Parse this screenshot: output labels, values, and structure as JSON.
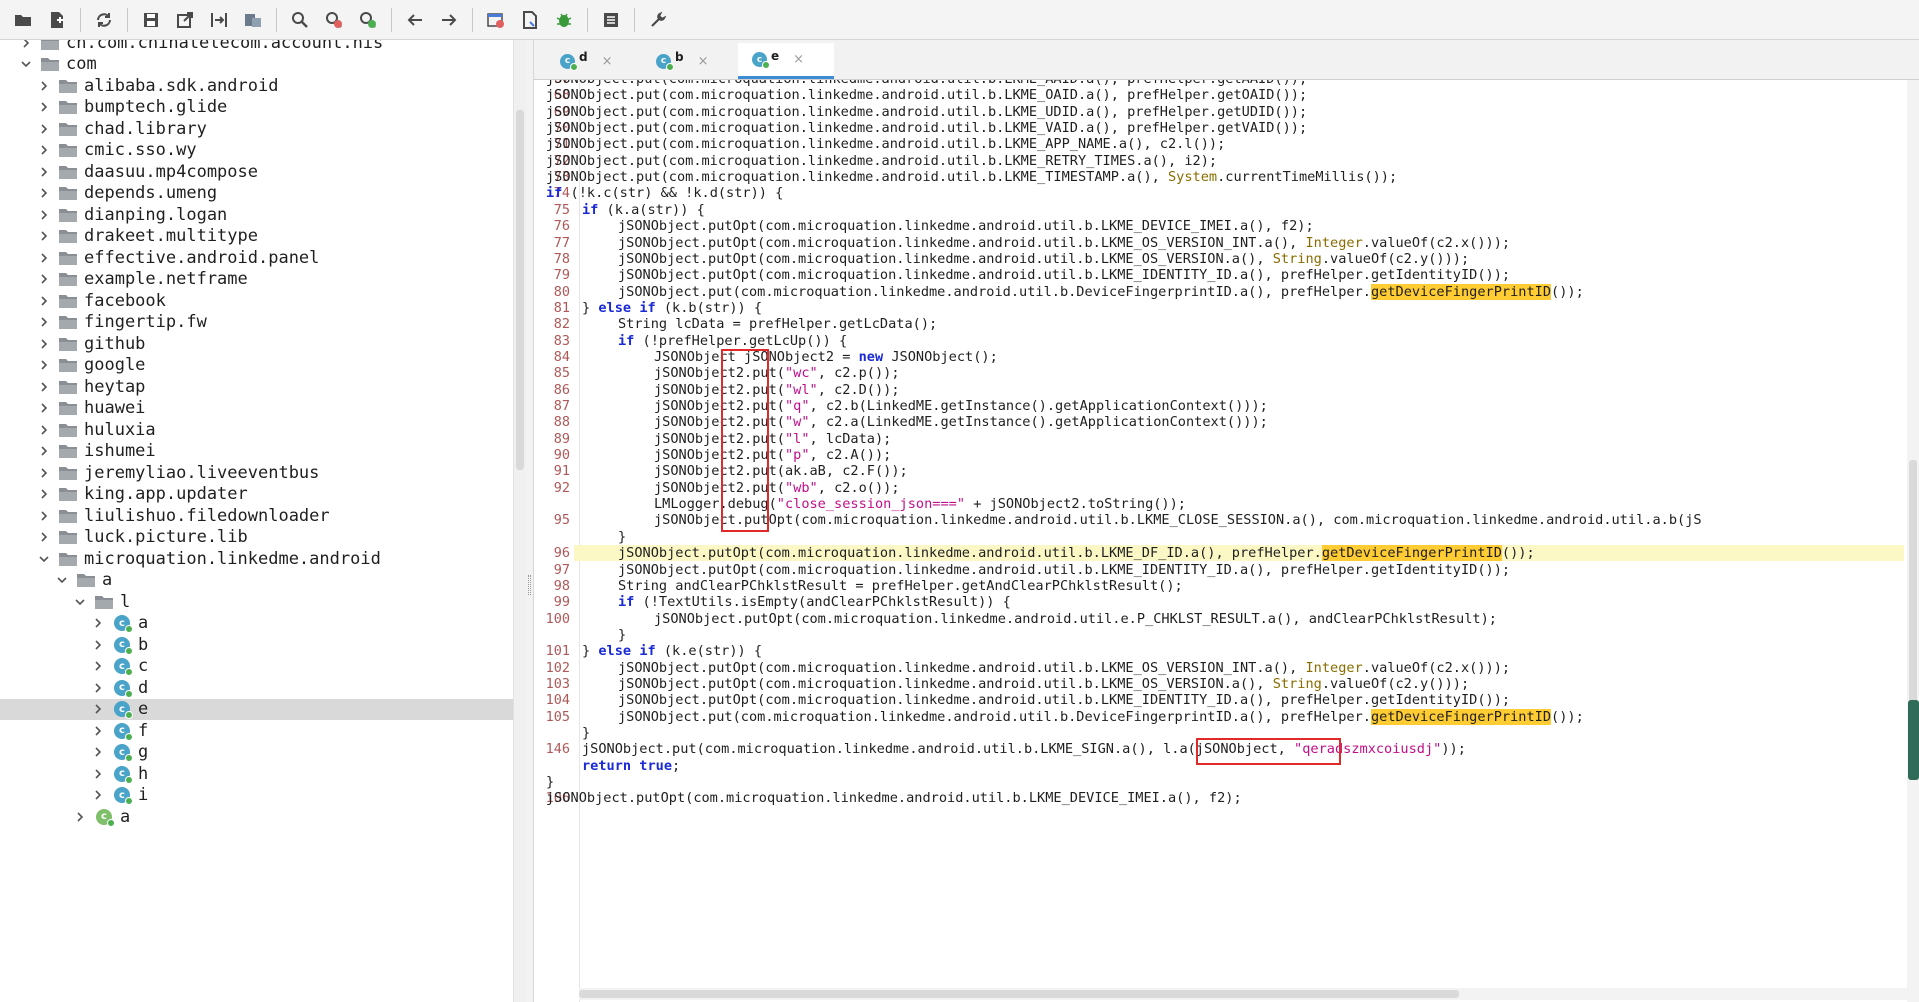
{
  "toolbar": {
    "buttons": [
      {
        "name": "open-folder-icon"
      },
      {
        "name": "add-file-icon"
      },
      {
        "name": "sync-icon"
      },
      {
        "name": "save-icon"
      },
      {
        "name": "export-icon"
      },
      {
        "name": "flatten-icon"
      },
      {
        "name": "packages-icon"
      },
      {
        "name": "search-icon"
      },
      {
        "name": "search-class-icon"
      },
      {
        "name": "search-usage-icon"
      },
      {
        "name": "back-arrow-icon"
      },
      {
        "name": "forward-arrow-icon"
      },
      {
        "name": "deobfuscate-icon"
      },
      {
        "name": "decompile-icon"
      },
      {
        "name": "debug-bug-icon"
      },
      {
        "name": "log-icon"
      },
      {
        "name": "preferences-icon"
      }
    ]
  },
  "tree": {
    "items": [
      {
        "label": "cn.com.chinatelecom.account.nis",
        "depth": 1,
        "type": "package",
        "expanded": false
      },
      {
        "label": "com",
        "depth": 1,
        "type": "package",
        "expanded": true
      },
      {
        "label": "alibaba.sdk.android",
        "depth": 2,
        "type": "package",
        "expanded": false
      },
      {
        "label": "bumptech.glide",
        "depth": 2,
        "type": "package",
        "expanded": false
      },
      {
        "label": "chad.library",
        "depth": 2,
        "type": "package",
        "expanded": false
      },
      {
        "label": "cmic.sso.wy",
        "depth": 2,
        "type": "package",
        "expanded": false
      },
      {
        "label": "daasuu.mp4compose",
        "depth": 2,
        "type": "package",
        "expanded": false
      },
      {
        "label": "depends.umeng",
        "depth": 2,
        "type": "package",
        "expanded": false
      },
      {
        "label": "dianping.logan",
        "depth": 2,
        "type": "package",
        "expanded": false
      },
      {
        "label": "drakeet.multitype",
        "depth": 2,
        "type": "package",
        "expanded": false
      },
      {
        "label": "effective.android.panel",
        "depth": 2,
        "type": "package",
        "expanded": false
      },
      {
        "label": "example.netframe",
        "depth": 2,
        "type": "package",
        "expanded": false
      },
      {
        "label": "facebook",
        "depth": 2,
        "type": "package",
        "expanded": false
      },
      {
        "label": "fingertip.fw",
        "depth": 2,
        "type": "package",
        "expanded": false
      },
      {
        "label": "github",
        "depth": 2,
        "type": "package",
        "expanded": false
      },
      {
        "label": "google",
        "depth": 2,
        "type": "package",
        "expanded": false
      },
      {
        "label": "heytap",
        "depth": 2,
        "type": "package",
        "expanded": false
      },
      {
        "label": "huawei",
        "depth": 2,
        "type": "package",
        "expanded": false
      },
      {
        "label": "huluxia",
        "depth": 2,
        "type": "package",
        "expanded": false
      },
      {
        "label": "ishumei",
        "depth": 2,
        "type": "package",
        "expanded": false
      },
      {
        "label": "jeremyliao.liveeventbus",
        "depth": 2,
        "type": "package",
        "expanded": false
      },
      {
        "label": "king.app.updater",
        "depth": 2,
        "type": "package",
        "expanded": false
      },
      {
        "label": "liulishuo.filedownloader",
        "depth": 2,
        "type": "package",
        "expanded": false
      },
      {
        "label": "luck.picture.lib",
        "depth": 2,
        "type": "package",
        "expanded": false
      },
      {
        "label": "microquation.linkedme.android",
        "depth": 2,
        "type": "package",
        "expanded": true
      },
      {
        "label": "a",
        "depth": 3,
        "type": "package",
        "expanded": true
      },
      {
        "label": "l",
        "depth": 4,
        "type": "package",
        "expanded": true
      },
      {
        "label": "a",
        "depth": 5,
        "type": "class",
        "expanded": false
      },
      {
        "label": "b",
        "depth": 5,
        "type": "class",
        "expanded": false
      },
      {
        "label": "c",
        "depth": 5,
        "type": "class",
        "expanded": false
      },
      {
        "label": "d",
        "depth": 5,
        "type": "class",
        "expanded": false
      },
      {
        "label": "e",
        "depth": 5,
        "type": "class",
        "expanded": false,
        "selected": true
      },
      {
        "label": "f",
        "depth": 5,
        "type": "class",
        "expanded": false
      },
      {
        "label": "g",
        "depth": 5,
        "type": "class",
        "expanded": false
      },
      {
        "label": "h",
        "depth": 5,
        "type": "class",
        "expanded": false
      },
      {
        "label": "i",
        "depth": 5,
        "type": "class",
        "expanded": false
      },
      {
        "label": "a",
        "depth": 4,
        "type": "class-partial",
        "expanded": false
      }
    ]
  },
  "tabs": [
    {
      "label": "d",
      "icon": "class-icon",
      "close": "×",
      "active": false
    },
    {
      "label": "b",
      "icon": "class-icon",
      "close": "×",
      "active": false
    },
    {
      "label": "e",
      "icon": "class-icon",
      "close": "×",
      "active": true
    }
  ],
  "code": {
    "lines": [
      {
        "num": "67",
        "indent": 2,
        "text": "jSONObject.put(com.microquation.linkedme.android.util.b.LKME_AAID.a(), prefHelper.getAAID());"
      },
      {
        "num": "68",
        "indent": 2,
        "text": "jSONObject.put(com.microquation.linkedme.android.util.b.LKME_OAID.a(), prefHelper.getOAID());"
      },
      {
        "num": "69",
        "indent": 2,
        "text": "jSONObject.put(com.microquation.linkedme.android.util.b.LKME_UDID.a(), prefHelper.getUDID());"
      },
      {
        "num": "70",
        "indent": 2,
        "text": "jSONObject.put(com.microquation.linkedme.android.util.b.LKME_VAID.a(), prefHelper.getVAID());"
      },
      {
        "num": "71",
        "indent": 2,
        "text": "jSONObject.put(com.microquation.linkedme.android.util.b.LKME_APP_NAME.a(), c2.l());"
      },
      {
        "num": "72",
        "indent": 2,
        "text": "jSONObject.put(com.microquation.linkedme.android.util.b.LKME_RETRY_TIMES.a(), i2);"
      },
      {
        "num": "73",
        "indent": 2,
        "text": "jSONObject.put(com.microquation.linkedme.android.util.b.LKME_TIMESTAMP.a(), System.currentTimeMillis());"
      },
      {
        "num": "74",
        "indent": 2,
        "text": "if (!k.c(str) && !k.d(str)) {"
      },
      {
        "num": "75",
        "indent": 3,
        "text": "if (k.a(str)) {"
      },
      {
        "num": "76",
        "indent": 4,
        "text": "jSONObject.putOpt(com.microquation.linkedme.android.util.b.LKME_DEVICE_IMEI.a(), f2);"
      },
      {
        "num": "77",
        "indent": 4,
        "text": "jSONObject.putOpt(com.microquation.linkedme.android.util.b.LKME_OS_VERSION_INT.a(), Integer.valueOf(c2.x()));"
      },
      {
        "num": "78",
        "indent": 4,
        "text": "jSONObject.putOpt(com.microquation.linkedme.android.util.b.LKME_OS_VERSION.a(), String.valueOf(c2.y()));"
      },
      {
        "num": "79",
        "indent": 4,
        "text": "jSONObject.putOpt(com.microquation.linkedme.android.util.b.LKME_IDENTITY_ID.a(), prefHelper.getIdentityID());"
      },
      {
        "num": "80",
        "indent": 4,
        "text": "jSONObject.put(com.microquation.linkedme.android.util.b.DeviceFingerprintID.a(), prefHelper.getDeviceFingerPrintID());"
      },
      {
        "num": "81",
        "indent": 3,
        "text": "} else if (k.b(str)) {"
      },
      {
        "num": "82",
        "indent": 4,
        "text": "String lcData = prefHelper.getLcData();"
      },
      {
        "num": "83",
        "indent": 4,
        "text": "if (!prefHelper.getLcUp()) {"
      },
      {
        "num": "84",
        "indent": 5,
        "text": "JSONObject jSONObject2 = new JSONObject();"
      },
      {
        "num": "85",
        "indent": 5,
        "text": "jSONObject2.put(\"wc\", c2.p());"
      },
      {
        "num": "86",
        "indent": 5,
        "text": "jSONObject2.put(\"wl\", c2.D());"
      },
      {
        "num": "87",
        "indent": 5,
        "text": "jSONObject2.put(\"q\", c2.b(LinkedME.getInstance().getApplicationContext()));"
      },
      {
        "num": "88",
        "indent": 5,
        "text": "jSONObject2.put(\"w\", c2.a(LinkedME.getInstance().getApplicationContext()));"
      },
      {
        "num": "89",
        "indent": 5,
        "text": "jSONObject2.put(\"l\", lcData);"
      },
      {
        "num": "90",
        "indent": 5,
        "text": "jSONObject2.put(\"p\", c2.A());"
      },
      {
        "num": "91",
        "indent": 5,
        "text": "jSONObject2.put(ak.aB, c2.F());"
      },
      {
        "num": "92",
        "indent": 5,
        "text": "jSONObject2.put(\"wb\", c2.o());"
      },
      {
        "num": "",
        "indent": 5,
        "text": "LMLogger.debug(\"close_session_json===\" + jSONObject2.toString());"
      },
      {
        "num": "95",
        "indent": 5,
        "text": "jSONObject.putOpt(com.microquation.linkedme.android.util.b.LKME_CLOSE_SESSION.a(), com.microquation.linkedme.android.util.a.b(jS"
      },
      {
        "num": "",
        "indent": 4,
        "text": "}"
      },
      {
        "num": "96",
        "indent": 4,
        "text": "jSONObject.putOpt(com.microquation.linkedme.android.util.b.LKME_DF_ID.a(), prefHelper.getDeviceFingerPrintID());"
      },
      {
        "num": "97",
        "indent": 4,
        "text": "jSONObject.putOpt(com.microquation.linkedme.android.util.b.LKME_IDENTITY_ID.a(), prefHelper.getIdentityID());"
      },
      {
        "num": "98",
        "indent": 4,
        "text": "String andClearPChklstResult = prefHelper.getAndClearPChklstResult();"
      },
      {
        "num": "99",
        "indent": 4,
        "text": "if (!TextUtils.isEmpty(andClearPChklstResult)) {"
      },
      {
        "num": "100",
        "indent": 5,
        "text": "jSONObject.putOpt(com.microquation.linkedme.android.util.e.P_CHKLST_RESULT.a(), andClearPChklstResult);"
      },
      {
        "num": "",
        "indent": 4,
        "text": "}"
      },
      {
        "num": "101",
        "indent": 3,
        "text": "} else if (k.e(str)) {"
      },
      {
        "num": "102",
        "indent": 4,
        "text": "jSONObject.putOpt(com.microquation.linkedme.android.util.b.LKME_OS_VERSION_INT.a(), Integer.valueOf(c2.x()));"
      },
      {
        "num": "103",
        "indent": 4,
        "text": "jSONObject.putOpt(com.microquation.linkedme.android.util.b.LKME_OS_VERSION.a(), String.valueOf(c2.y()));"
      },
      {
        "num": "104",
        "indent": 4,
        "text": "jSONObject.putOpt(com.microquation.linkedme.android.util.b.LKME_IDENTITY_ID.a(), prefHelper.getIdentityID());"
      },
      {
        "num": "105",
        "indent": 4,
        "text": "jSONObject.put(com.microquation.linkedme.android.util.b.DeviceFingerprintID.a(), prefHelper.getDeviceFingerPrintID());"
      },
      {
        "num": "",
        "indent": 3,
        "text": "}"
      },
      {
        "num": "146",
        "indent": 3,
        "text": "jSONObject.put(com.microquation.linkedme.android.util.b.LKME_SIGN.a(), l.a(jSONObject, \"qeradszmxcoiusdj\"));"
      },
      {
        "num": "",
        "indent": 3,
        "text": "return true;"
      },
      {
        "num": "",
        "indent": 2,
        "text": "}"
      },
      {
        "num": "106",
        "indent": 2,
        "text": "jSONObject.putOpt(com.microquation.linkedme.android.util.b.LKME_DEVICE_IMEI.a(), f2);"
      }
    ],
    "highlighted_line": "96",
    "marked_word": "getDeviceFingerPrintID",
    "keywords": [
      "if",
      "else",
      "new",
      "return",
      "true"
    ],
    "class_words": [
      "System",
      "Integer",
      "String"
    ]
  },
  "colors": {
    "keyword": "#1a2bd6",
    "string": "#c00f8a",
    "class": "#8a6d00",
    "line_number": "#b05858",
    "highlight_line": "#fbf8c5",
    "mark": "#ffcc33",
    "annotation_box": "#e02a2a",
    "active_tab_underline": "#3d8bd4",
    "selected_row": "#d9d9d9"
  }
}
